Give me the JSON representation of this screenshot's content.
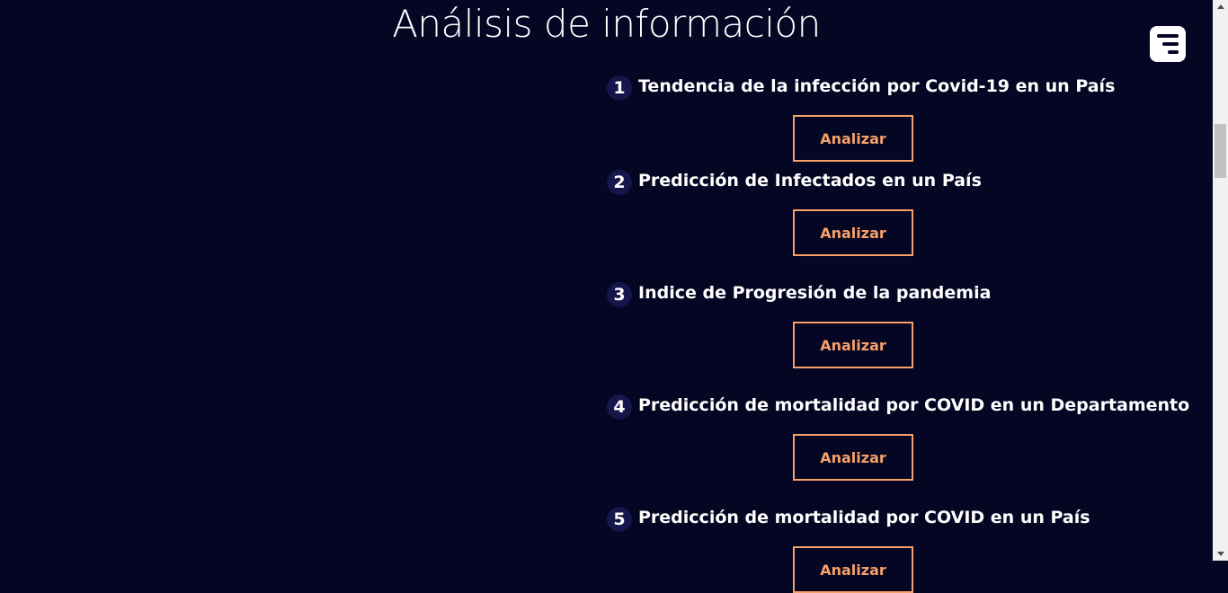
{
  "header": {
    "title": "Análisis de información",
    "menu_icon": "menu-icon"
  },
  "items": [
    {
      "number": "1",
      "title": "Tendencia de la infección por Covid-19 en un País",
      "button": "Analizar"
    },
    {
      "number": "2",
      "title": "Predicción de Infectados en un País",
      "button": "Analizar"
    },
    {
      "number": "3",
      "title": "Indice de Progresión de la pandemia",
      "button": "Analizar"
    },
    {
      "number": "4",
      "title": "Predicción de mortalidad por COVID en un Departamento",
      "button": "Analizar"
    },
    {
      "number": "5",
      "title": "Predicción de mortalidad por COVID en un País",
      "button": "Analizar"
    }
  ],
  "colors": {
    "background": "#050623",
    "accent": "#f6a06a",
    "number_badge": "#15164a",
    "text": "#ffffff"
  }
}
